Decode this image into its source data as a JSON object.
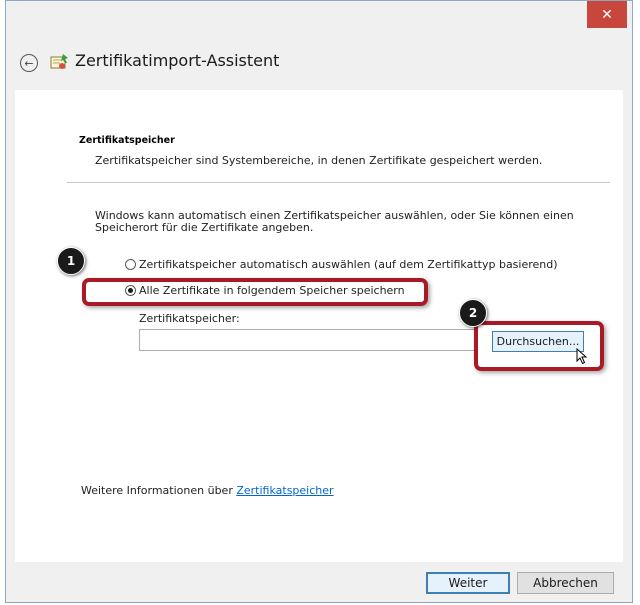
{
  "window": {
    "close_glyph": "✕"
  },
  "header": {
    "back_glyph": "←",
    "title": "Zertifikatimport-Assistent",
    "icon": "certificate-wizard-icon"
  },
  "page": {
    "section_heading": "Zertifikatspeicher",
    "section_description": "Zertifikatspeicher sind Systembereiche, in denen Zertifikate gespeichert werden.",
    "intro_line1": "Windows kann automatisch einen Zertifikatspeicher auswählen, oder Sie können einen",
    "intro_line2": "Speicherort für die Zertifikate angeben.",
    "options": [
      {
        "label": "Zertifikatspeicher automatisch auswählen (auf dem Zertifikattyp basierend)",
        "selected": false
      },
      {
        "label": "Alle Zertifikate in folgendem Speicher speichern",
        "selected": true
      }
    ],
    "store_label": "Zertifikatspeicher:",
    "store_value": "",
    "browse_label": "Durchsuchen...",
    "more_info_text": "Weitere Informationen über ",
    "more_info_link": "Zertifikatspeicher"
  },
  "footer": {
    "next_label": "Weiter",
    "cancel_label": "Abbrechen"
  },
  "annotations": {
    "badge_1": "1",
    "badge_2": "2",
    "highlight_color": "#a91a26"
  },
  "colors": {
    "window_bg": "#f0f0f0",
    "content_bg": "#ffffff",
    "close_button": "#c7473c",
    "link": "#0066cc",
    "focus_border": "#3c7fb1"
  }
}
